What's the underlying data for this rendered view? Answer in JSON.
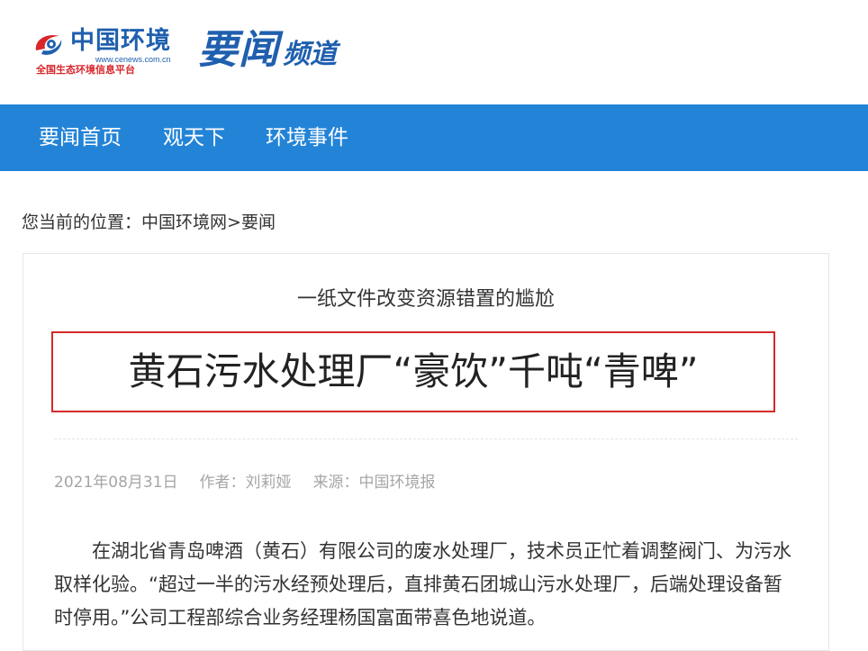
{
  "header": {
    "logo": {
      "name": "中国环境",
      "url_text": "www.cenews.com.cn",
      "slogan": "全国生态环境信息平台"
    },
    "channel": {
      "main": "要闻",
      "sub": "频道"
    }
  },
  "nav": {
    "items": [
      {
        "label": "要闻首页"
      },
      {
        "label": "观天下"
      },
      {
        "label": "环境事件"
      }
    ]
  },
  "breadcrumb": {
    "prefix": "您当前的位置：",
    "home": "中国环境网",
    "separator": ">",
    "current": "要闻"
  },
  "article": {
    "subtitle": "一纸文件改变资源错置的尴尬",
    "headline": "黄石污水处理厂“豪饮”千吨“青啤”",
    "date": "2021年08月31日",
    "author": "作者：刘莉娅",
    "source": "来源：中国环境报",
    "paragraph": "在湖北省青岛啤酒（黄石）有限公司的废水处理厂，技术员正忙着调整阀门、为污水取样化验。“超过一半的污水经预处理后，直排黄石团城山污水处理厂，后端处理设备暂时停用。”公司工程部综合业务经理杨国富面带喜色地说道。"
  },
  "colors": {
    "brand_blue": "#1f5fae",
    "nav_blue": "#2384d7",
    "highlight_red": "#d52a2a",
    "slogan_red": "#d8262b"
  }
}
